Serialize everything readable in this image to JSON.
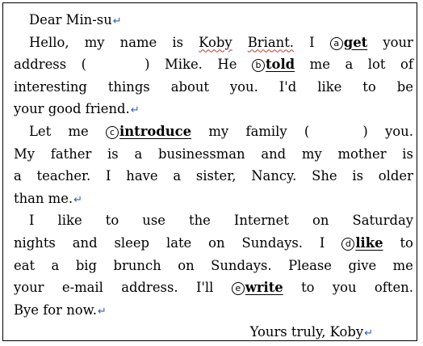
{
  "letter": {
    "salutation": "Dear Min-su",
    "p1": {
      "hello": "Hello,",
      "my": "my",
      "name": "name",
      "is": "is",
      "koby": "Koby",
      "briant": "Briant.",
      "i": "I",
      "a_mark": "a",
      "a_word": "get",
      "your": "your",
      "address": "address",
      "paren_open": "(",
      "paren_close": ")",
      "mike": "Mike.",
      "he": "He",
      "b_mark": "b",
      "b_word": "told",
      "me": "me",
      "a": "a",
      "lot": "lot",
      "of": "of",
      "interesting": "interesting",
      "things": "things",
      "about": "about",
      "you": "you.",
      "id": "I'd",
      "like": "like",
      "to": "to",
      "be": "be",
      "end": "your good friend."
    },
    "p2": {
      "let": "Let",
      "me": "me",
      "c_mark": "c",
      "c_word": "introduce",
      "my": "my",
      "family": "family",
      "paren_open": "(",
      "paren_close": ")",
      "you": "you.",
      "l2": [
        "My",
        "father",
        "is",
        "a",
        "businessman",
        "and",
        "my",
        "mother",
        "is"
      ],
      "l3": [
        "a",
        "teacher.",
        "I",
        "have",
        "a",
        "sister,",
        "Nancy.",
        "She",
        "is",
        "older"
      ],
      "end": "than me."
    },
    "p3": {
      "l1": [
        "I",
        "like",
        "to",
        "use",
        "the",
        "Internet",
        "on",
        "Saturday"
      ],
      "l2a": [
        "nights",
        "and",
        "sleep",
        "late",
        "on",
        "Sundays.",
        "I"
      ],
      "d_mark": "d",
      "d_word": "like",
      "l2_end": "to",
      "l3": [
        "eat",
        "a",
        "big",
        "brunch",
        "on",
        "Sundays.",
        "Please",
        "give",
        "me"
      ],
      "l4a": [
        "your",
        "e-mail",
        "address.",
        "I'll"
      ],
      "e_mark": "e",
      "e_word": "write",
      "l4b": [
        "to",
        "you",
        "often."
      ],
      "end": "Bye for now."
    },
    "closing": "Yours truly, Koby",
    "para_mark": "↵"
  }
}
